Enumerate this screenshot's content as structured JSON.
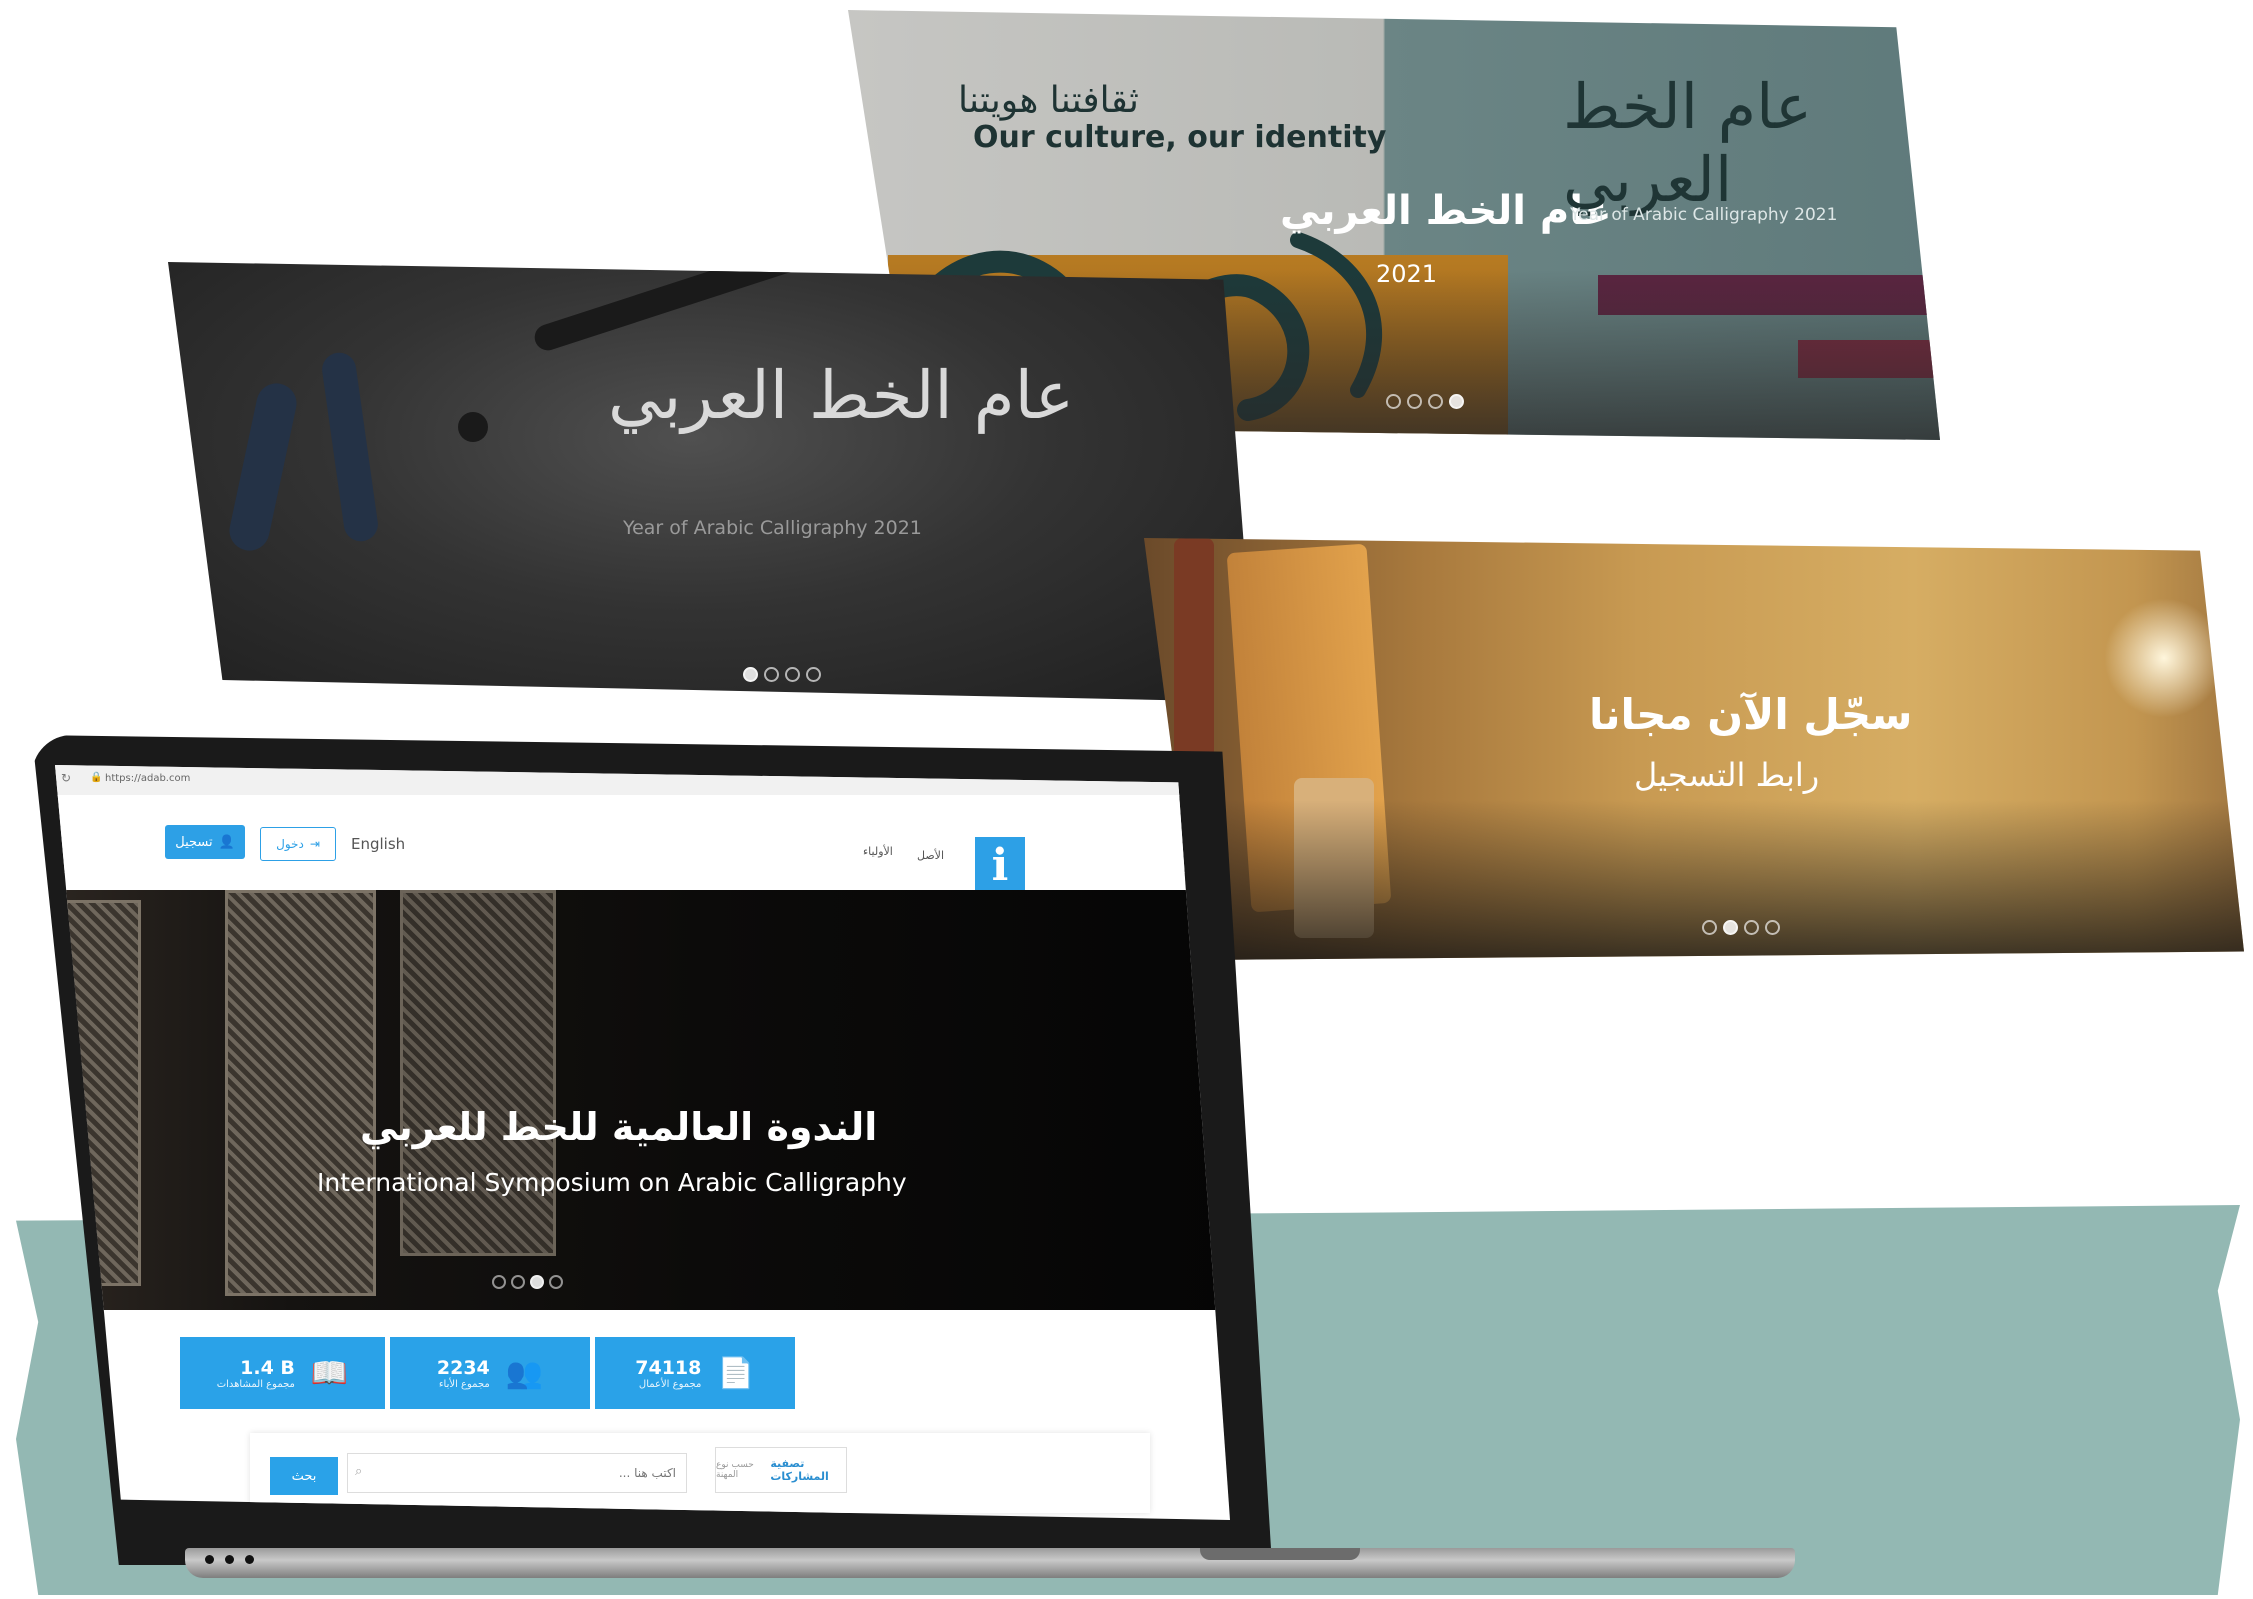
{
  "slide_a": {
    "tagline_ar": "ثقافتنا هويتنا",
    "tagline_en": "Our culture, our identity",
    "title_ar": "عام الخط العربي",
    "year": "2021",
    "logo_caption": "Year of Arabic Calligraphy 2021",
    "logo_glyphs": "عام الخط العربي"
  },
  "slide_b": {
    "logo_glyphs": "عام الخط العربي",
    "caption": "Year of Arabic Calligraphy 2021"
  },
  "slide_c": {
    "line1": "سجّل الآن مجانا",
    "line2": "رابط التسجيل"
  },
  "browser": {
    "url": "https://adab.com"
  },
  "site": {
    "signup_label": "تسجيل",
    "login_label": "دخول",
    "language_label": "English",
    "menu_home": "الأصل",
    "menu_parents": "الأولياء",
    "logo_letter": "i",
    "hero_title_ar": "الندوة العالمية للخط للعربي",
    "hero_title_en": "International Symposium on Arabic Calligraphy",
    "stats": [
      {
        "value": "1.4 B",
        "label": "مجموع المشاهدات",
        "icon": "book-icon"
      },
      {
        "value": "2234",
        "label": "مجموع الأباء",
        "icon": "users-icon"
      },
      {
        "value": "74118",
        "label": "مجموع الأعمال",
        "icon": "document-icon"
      }
    ],
    "search_button": "بحث",
    "search_placeholder": "اكتب هنا ...",
    "filter_title": "تصفية المشاركات",
    "filter_sub": "حسب نوع المهنة"
  },
  "colors": {
    "accent": "#2aa2e8",
    "teal_band": "#93b8b3"
  }
}
